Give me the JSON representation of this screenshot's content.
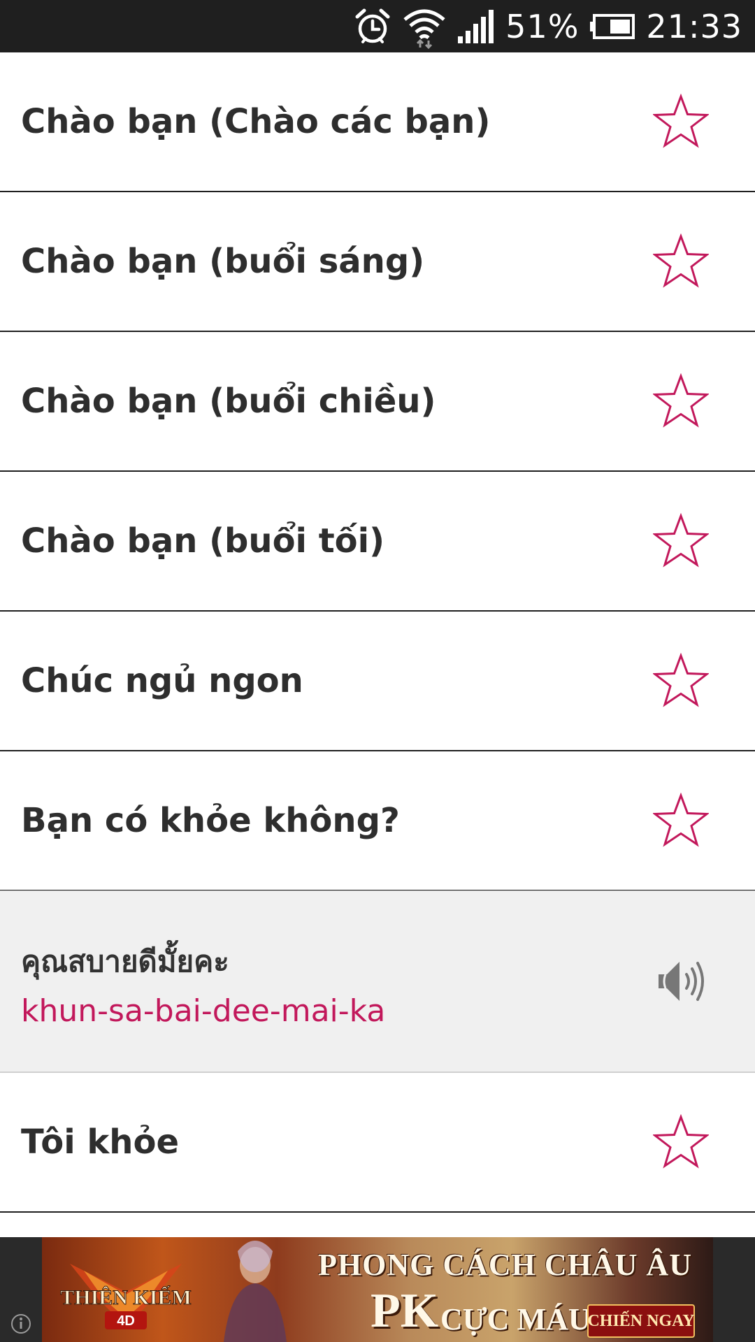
{
  "status_bar": {
    "battery_percent": "51%",
    "time": "21:33",
    "icons": [
      "alarm-icon",
      "wifi-icon",
      "signal-icon",
      "battery-icon"
    ]
  },
  "phrases": [
    {
      "label": "Chào bạn (Chào các bạn)",
      "icon": "star-icon"
    },
    {
      "label": "Chào bạn (buổi sáng)",
      "icon": "star-icon"
    },
    {
      "label": "Chào bạn (buổi chiều)",
      "icon": "star-icon"
    },
    {
      "label": "Chào bạn (buổi tối)",
      "icon": "star-icon"
    },
    {
      "label": "Chúc ngủ ngon",
      "icon": "star-icon"
    },
    {
      "label": "Bạn có khỏe không?",
      "icon": "star-icon"
    },
    {
      "label": "Tôi khỏe",
      "icon": "star-icon"
    }
  ],
  "expanded": {
    "thai": "คุณสบายดีมั้ยคะ",
    "romanization": "khun-sa-bai-dee-mai-ka",
    "icon": "speaker-icon"
  },
  "ad": {
    "logo_text": "THIÊN KIẾM 4D",
    "headline": "PHONG CÁCH CHÂU ÂU",
    "pk": "PK",
    "sub": "CỰC MÁU",
    "cta": "CHIẾN NGAY"
  },
  "colors": {
    "accent": "#c2185b",
    "status_bar": "#1f1f1f",
    "expanded_bg": "#f0f0f0",
    "text": "#2e2e2e"
  }
}
